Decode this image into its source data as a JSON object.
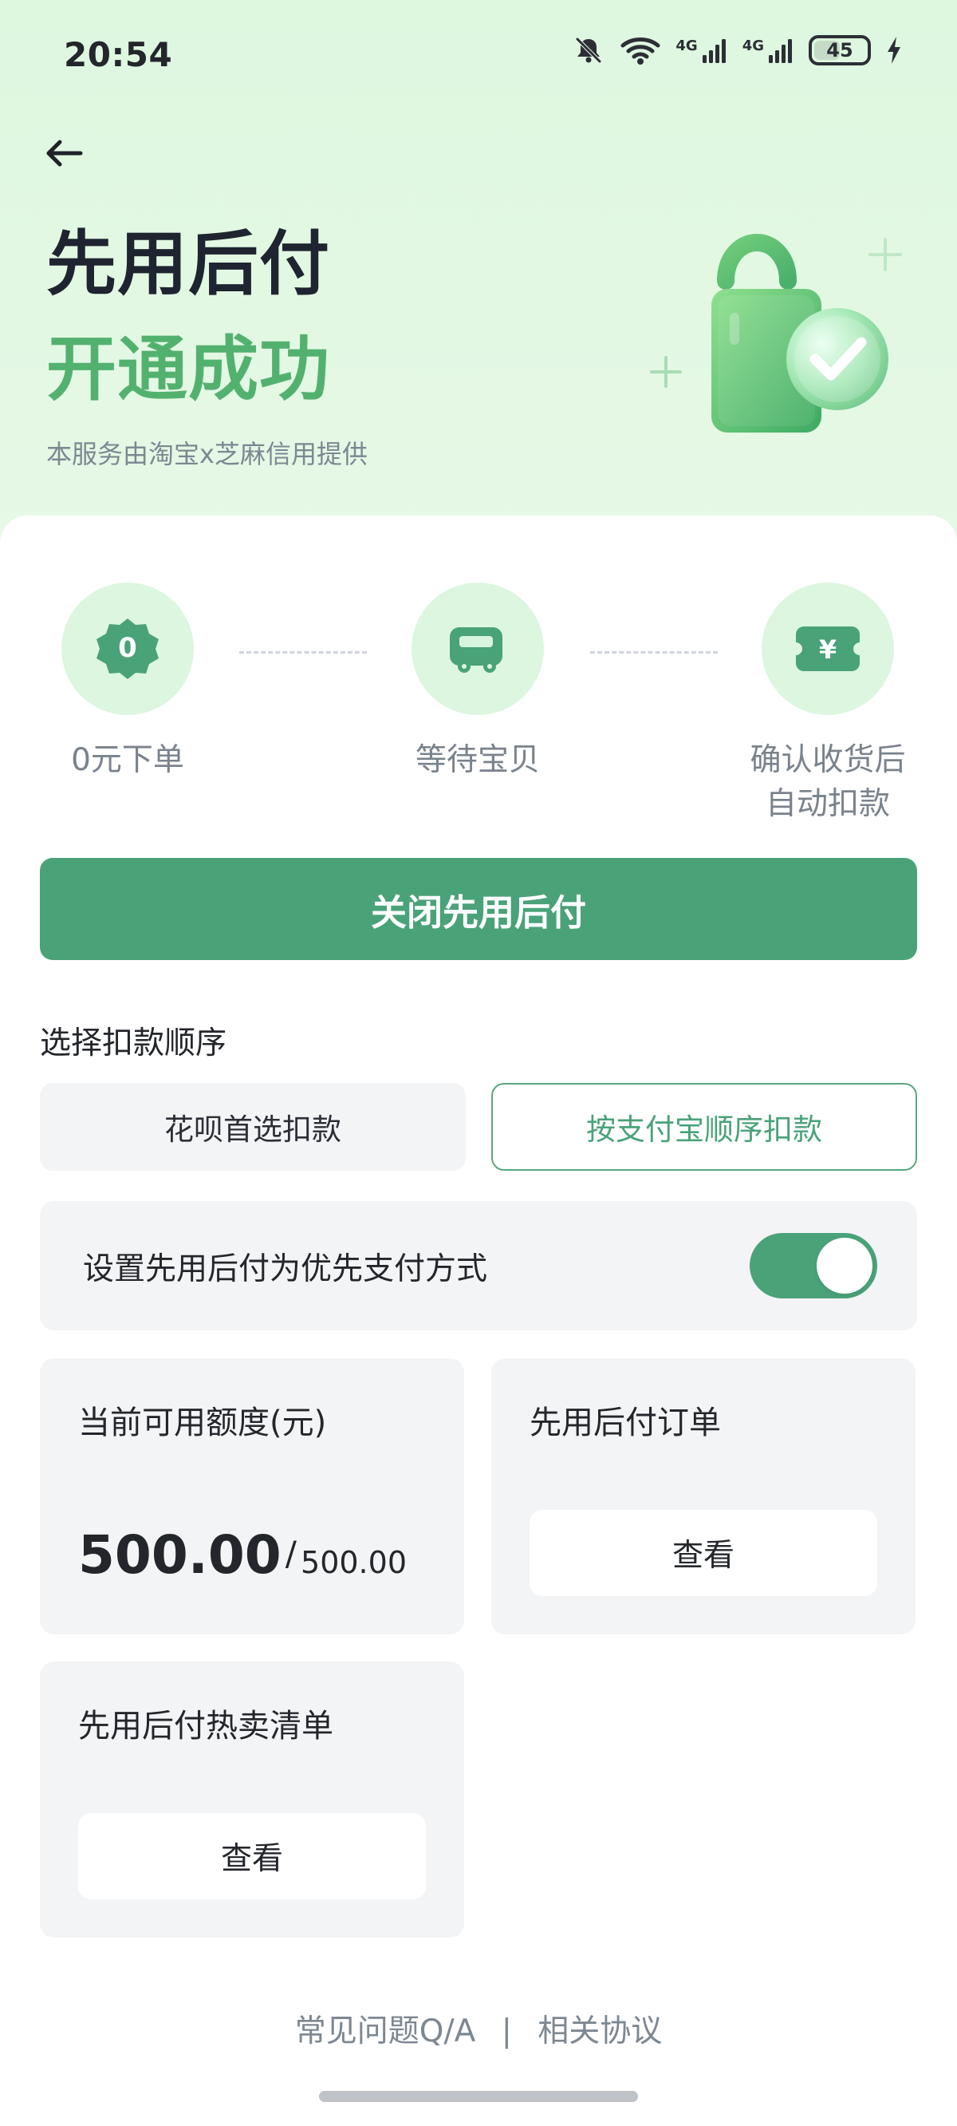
{
  "status_bar": {
    "time": "20:54",
    "battery": "45",
    "signal_left": "4G",
    "signal_right": "4G",
    "icons": [
      "bell-off-icon",
      "wifi-icon",
      "signal-icon",
      "signal-icon",
      "battery-icon",
      "charging-icon"
    ]
  },
  "header": {
    "back_icon": "arrow-left-icon",
    "title": "先用后付",
    "subtitle": "开通成功",
    "note": "本服务由淘宝x芝麻信用提供",
    "illustration": "shopping-bag-check-icon"
  },
  "steps": [
    {
      "label": "0元下单",
      "icon": "zero-badge-icon"
    },
    {
      "label": "等待宝贝",
      "icon": "truck-icon"
    },
    {
      "label": "确认收货后\n自动扣款",
      "icon": "yen-ticket-icon"
    }
  ],
  "primary_action": {
    "label": "关闭先用后付"
  },
  "payment_order": {
    "title": "选择扣款顺序",
    "options": [
      {
        "label": "花呗首选扣款",
        "selected": false
      },
      {
        "label": "按支付宝顺序扣款",
        "selected": true
      }
    ]
  },
  "preference": {
    "label": "设置先用后付为优先支付方式",
    "enabled": true
  },
  "cards": {
    "credit": {
      "title": "当前可用额度(元)",
      "value": "500.00",
      "separator": "/",
      "total": "500.00"
    },
    "orders": {
      "title": "先用后付订单",
      "button": "查看"
    },
    "bestsellers": {
      "title": "先用后付热卖清单",
      "button": "查看"
    }
  },
  "footer": {
    "faq": "常见问题Q/A",
    "divider": "|",
    "agreement": "相关协议"
  },
  "colors": {
    "header_bg": "#def7df",
    "accent_green": "#4aa279",
    "title_green": "#53b16f",
    "soft_green": "#dcf6df",
    "card_bg": "#f3f4f6",
    "text_dark": "#23262b",
    "text_muted": "#7d8791"
  }
}
